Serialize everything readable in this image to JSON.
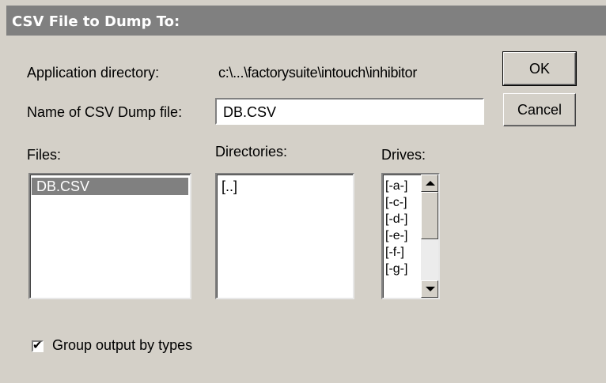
{
  "dialog": {
    "title": "CSV File to Dump To:"
  },
  "app_dir": {
    "label": "Application directory:",
    "value": "c:\\...\\factorysuite\\intouch\\inhibitor"
  },
  "dump_file": {
    "label": "Name of CSV Dump file:",
    "value": "DB.CSV"
  },
  "buttons": {
    "ok": "OK",
    "cancel": "Cancel"
  },
  "files": {
    "label": "Files:",
    "items": [
      "DB.CSV"
    ],
    "selected_index": 0
  },
  "directories": {
    "label": "Directories:",
    "items": [
      "[..]"
    ]
  },
  "drives": {
    "label": "Drives:",
    "items": [
      "[-a-]",
      "[-c-]",
      "[-d-]",
      "[-e-]",
      "[-f-]",
      "[-g-]"
    ]
  },
  "group_output": {
    "label": "Group output by types",
    "checked": true
  },
  "icons": {
    "scroll_up": "arrow-up-icon",
    "scroll_down": "arrow-down-icon",
    "checkmark": "checkmark-icon"
  },
  "colors": {
    "title_bar": "#808080",
    "dialog_bg": "#d4d0c8",
    "selection": "#808080"
  }
}
